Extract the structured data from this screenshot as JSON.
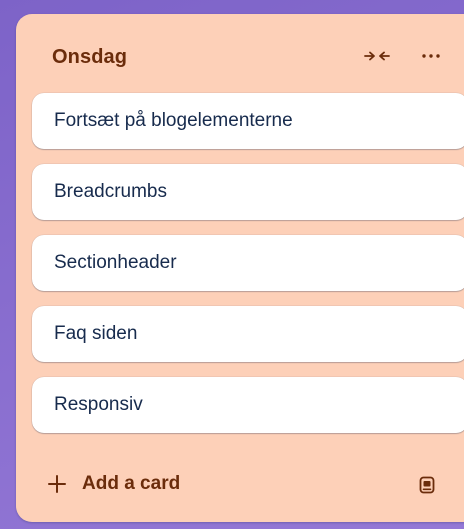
{
  "list": {
    "title": "Onsdag",
    "add_card_label": "Add a card",
    "cards": [
      {
        "title": "Fortsæt på blogelementerne"
      },
      {
        "title": "Breadcrumbs"
      },
      {
        "title": "Sectionheader"
      },
      {
        "title": "Faq siden"
      },
      {
        "title": "Responsiv"
      }
    ]
  },
  "icons": {
    "collapse": "collapse-arrows-icon",
    "more": "more-dots-icon",
    "add": "plus-icon",
    "template": "card-template-icon"
  },
  "colors": {
    "board_background": "#8a6fd0",
    "list_background": "#fdd0b8",
    "list_accent_text": "#6b2c0b",
    "card_background": "#ffffff",
    "card_text": "#172b4d"
  }
}
